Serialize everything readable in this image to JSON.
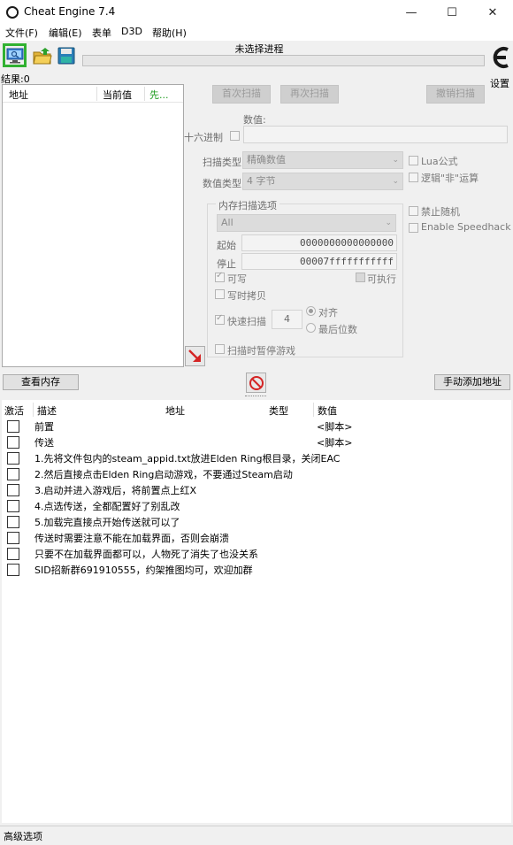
{
  "window": {
    "title": "Cheat Engine 7.4",
    "minimize": "—",
    "maximize": "☐",
    "close": "✕"
  },
  "menu": {
    "items": [
      "文件(F)",
      "编辑(E)",
      "表单",
      "D3D",
      "帮助(H)"
    ]
  },
  "toolbar": {
    "process_label": "未选择进程",
    "settings_label": "设置",
    "results_label": "结果:0"
  },
  "address_list": {
    "columns": [
      "地址",
      "当前值",
      "先..."
    ]
  },
  "scan": {
    "first_scan": "首次扫描",
    "next_scan": "再次扫描",
    "undo_scan": "撤销扫描",
    "value_label": "数值:",
    "hex_label": "十六进制",
    "scan_type_label": "扫描类型",
    "scan_type_value": "精确数值",
    "value_type_label": "数值类型",
    "value_type_value": "4 字节",
    "lua_formula": "Lua公式",
    "logic_not": "逻辑\"非\"运算",
    "no_random": "禁止随机",
    "speedhack": "Enable Speedhack",
    "mem_options_title": "内存扫描选项",
    "mem_region": "All",
    "start_label": "起始",
    "start_value": "0000000000000000",
    "stop_label": "停止",
    "stop_value": "00007fffffffffff",
    "writable": "可写",
    "executable": "可执行",
    "copy_on_write": "写时拷贝",
    "fast_scan": "快速扫描",
    "fast_scan_value": "4",
    "align": "对齐",
    "last_digits": "最后位数",
    "pause_game": "扫描时暂停游戏"
  },
  "bottom_toolbar": {
    "view_memory": "查看内存",
    "add_address_manually": "手动添加地址"
  },
  "cheat_table": {
    "columns": [
      "激活",
      "描述",
      "地址",
      "类型",
      "数值"
    ],
    "rows": [
      {
        "desc": "前置",
        "value": "<脚本>"
      },
      {
        "desc": "传送",
        "value": "<脚本>"
      },
      {
        "desc": "1.先将文件包内的steam_appid.txt放进Elden Ring根目录，关闭EAC",
        "value": ""
      },
      {
        "desc": "2.然后直接点击Elden Ring启动游戏，不要通过Steam启动",
        "value": ""
      },
      {
        "desc": "3.启动并进入游戏后，将前置点上红X",
        "value": ""
      },
      {
        "desc": "4.点选传送，全都配置好了别乱改",
        "value": ""
      },
      {
        "desc": "5.加载完直接点开始传送就可以了",
        "value": ""
      },
      {
        "desc": "传送时需要注意不能在加载界面，否则会崩溃",
        "value": ""
      },
      {
        "desc": "只要不在加载界面都可以，人物死了消失了也没关系",
        "value": ""
      },
      {
        "desc": "SID招新群691910555，约架推图均可，欢迎加群",
        "value": ""
      }
    ]
  },
  "footer": {
    "advanced_options": "高级选项"
  },
  "colors": {
    "active_tool_border": "#31b131",
    "disabled_text": "#9b9b9b",
    "ce_logo": "#1a1a1a"
  }
}
